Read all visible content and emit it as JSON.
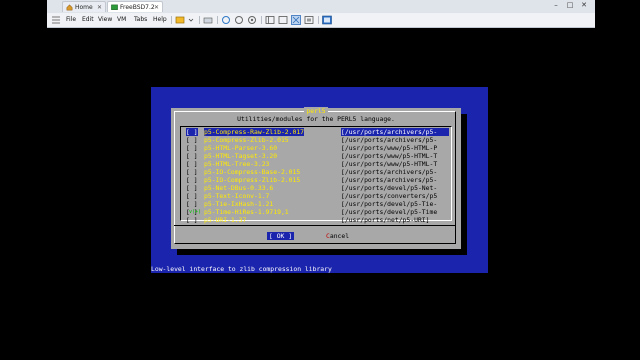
{
  "window": {
    "tabs": [
      {
        "label": "Home",
        "icon": "home-icon"
      },
      {
        "label": "FreeBSD7.2",
        "icon": "vm-icon"
      }
    ],
    "controls": {
      "minimize": "–",
      "maximize": "□",
      "close": "✕"
    },
    "menu": [
      "File",
      "Edit",
      "View",
      "VM",
      "Tabs",
      "Help"
    ]
  },
  "dialog": {
    "title": "perl5",
    "subtitle": "Utilities/modules for the PERL5 language.",
    "items": [
      {
        "check": "[ ]",
        "name": "p5-Compress-Raw-Zlib-2.017",
        "path": "[/usr/ports/archivers/p5-",
        "selected": true
      },
      {
        "check": "[ ]",
        "name": "p5-Compress-Zlib-2.015",
        "path": "[/usr/ports/archivers/p5-"
      },
      {
        "check": "[ ]",
        "name": "p5-HTML-Parser-3.60",
        "path": "[/usr/ports/www/p5-HTML-P"
      },
      {
        "check": "[ ]",
        "name": "p5-HTML-Tagset-3.20",
        "path": "[/usr/ports/www/p5-HTML-T"
      },
      {
        "check": "[ ]",
        "name": "p5-HTML-Tree-3.23",
        "path": "[/usr/ports/www/p5-HTML-T"
      },
      {
        "check": "[ ]",
        "name": "p5-IO-Compress-Base-2.015",
        "path": "[/usr/ports/archivers/p5-"
      },
      {
        "check": "[ ]",
        "name": "p5-IO-Compress-Zlib-2.015",
        "path": "[/usr/ports/archivers/p5-"
      },
      {
        "check": "[ ]",
        "name": "p5-Net-DBus-0.33.6",
        "path": "[/usr/ports/devel/p5-Net-"
      },
      {
        "check": "[ ]",
        "name": "p5-Text-Iconv-1.7",
        "path": "[/usr/ports/converters/p5"
      },
      {
        "check": "[ ]",
        "name": "p5-Tie-IxHash-1.21",
        "path": "[/usr/ports/devel/p5-Tie-"
      },
      {
        "check": "[ ]",
        "name": "p5-Time-HiRes-1.9719,1",
        "path": "[/usr/ports/devel/p5-Time"
      },
      {
        "check": "[ ]",
        "name": "p5-URI-1.37",
        "path": "[/usr/ports/net/p5-URI]"
      }
    ],
    "more_indicator": "v(+)",
    "ok_label": "[  OK  ]",
    "cancel_hotkey": "C",
    "cancel_rest": "ancel"
  },
  "status_line": "Low-level interface to zlib compression library",
  "colors": {
    "screen_blue": "#1b24ad",
    "dialog_gray": "#a8a8a8",
    "item_yellow": "#ffea00",
    "hotkey_red": "#c00000"
  }
}
